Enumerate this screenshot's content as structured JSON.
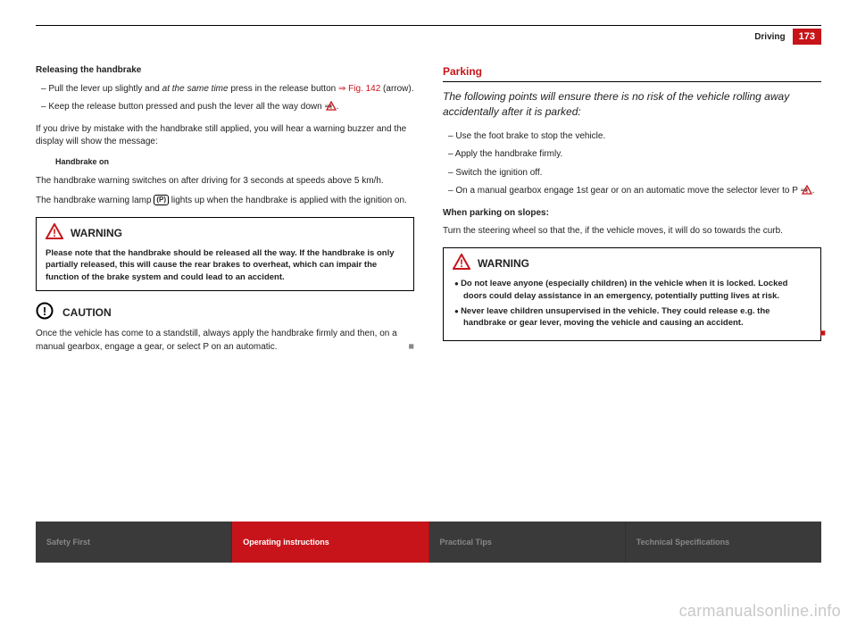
{
  "header": {
    "section": "Driving",
    "page": "173"
  },
  "left": {
    "h1": "Releasing the handbrake",
    "li1a": "Pull the lever up slightly and ",
    "li1b": "at the same time",
    "li1c": " press in the release button ",
    "li1ref": "⇒ Fig. 142",
    "li1d": " (arrow).",
    "li2a": "Keep the release button pressed and push the lever all the way down ⇒ ",
    "p1": "If you drive by mistake with the handbrake still applied, you will hear a warning buzzer and the display will show the message:",
    "msg": "Handbrake on",
    "p2": "The handbrake warning switches on after driving for 3 seconds at speeds above 5 km/h.",
    "p3a": "The handbrake warning lamp ",
    "p3b": " lights up when the handbrake is applied with the ignition on.",
    "warn_title": "WARNING",
    "warn_body": "Please note that the handbrake should be released all the way. If the handbrake is only partially released, this will cause the rear brakes to overheat, which can impair the function of the brake system and could lead to an accident.",
    "caution_title": "CAUTION",
    "caution_body": "Once the vehicle has come to a standstill, always apply the handbrake firmly and then, on a manual gearbox, engage a gear, or select P on an automatic."
  },
  "right": {
    "h2": "Parking",
    "intro": "The following points will ensure there is no risk of the vehicle rolling away accidentally after it is parked:",
    "li1": "Use the foot brake to stop the vehicle.",
    "li2": "Apply the handbrake firmly.",
    "li3": "Switch the ignition off.",
    "li4a": "On a manual gearbox engage 1st gear or on an automatic move the selector lever to P ⇒ ",
    "sub": "When parking on slopes:",
    "p1": "Turn the steering wheel so that the, if the vehicle moves, it will do so towards the curb.",
    "warn_title": "WARNING",
    "warn_b1": "Do not leave anyone (especially children) in the vehicle when it is locked. Locked doors could delay assistance in an emergency, potentially putting lives at risk.",
    "warn_b2": "Never leave children unsupervised in the vehicle. They could release e.g. the handbrake or gear lever, moving the vehicle and causing an accident."
  },
  "nav": {
    "c1": "Safety First",
    "c2": "Operating instructions",
    "c3": "Practical Tips",
    "c4": "Technical Specifications"
  },
  "watermark": "carmanualsonline.info"
}
